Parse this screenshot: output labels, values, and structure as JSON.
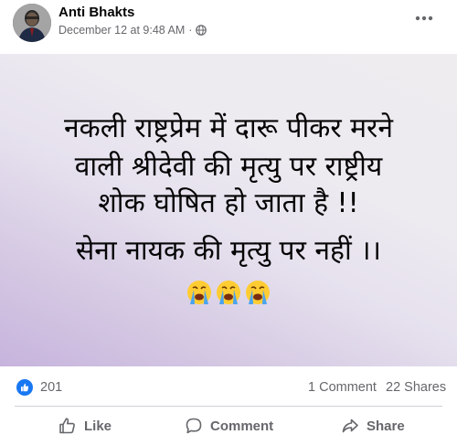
{
  "post": {
    "author": "Anti Bhakts",
    "timestamp": "December 12 at 9:48 AM",
    "separator": "·",
    "privacy_icon": "globe-icon",
    "more_icon": "ellipsis-icon"
  },
  "banner": {
    "line1": "नकली राष्ट्रप्रेम में दारू पीकर मरने",
    "line2": "वाली श्रीदेवी की मृत्यु पर राष्ट्रीय",
    "line3": "शोक घोषित हो जाता है !!",
    "line4": "सेना नायक की मृत्यु पर नहीं ।।",
    "emoji": [
      "loudly-crying-face",
      "loudly-crying-face",
      "loudly-crying-face"
    ],
    "gradient_colors": [
      "#c7b4dd",
      "#eeecef"
    ]
  },
  "reactions": {
    "like_count": "201",
    "comments": "1 Comment",
    "shares": "22 Shares"
  },
  "actions": {
    "like": "Like",
    "comment": "Comment",
    "share": "Share"
  },
  "colors": {
    "accent": "#1877f2",
    "secondary_text": "#65676b"
  }
}
